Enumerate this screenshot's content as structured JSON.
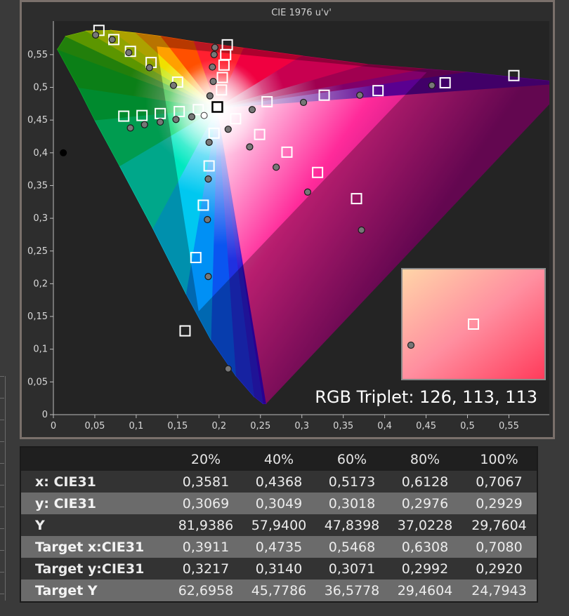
{
  "chart_data": {
    "type": "scatter",
    "title": "CIE 1976 u'v'",
    "xlim": [
      0,
      0.6
    ],
    "ylim": [
      0,
      0.6
    ],
    "x_ticks": [
      "0",
      "0,05",
      "0,1",
      "0,15",
      "0,2",
      "0,25",
      "0,3",
      "0,35",
      "0,4",
      "0,45",
      "0,5",
      "0,55"
    ],
    "y_ticks": [
      "0",
      "0,05",
      "0,1",
      "0,15",
      "0,2",
      "0,25",
      "0,3",
      "0,35",
      "0,4",
      "0,45",
      "0,5",
      "0,55"
    ],
    "grid": false,
    "series": [
      {
        "marker": "square",
        "points": [
          [
            0.055,
            0.587
          ],
          [
            0.073,
            0.573
          ],
          [
            0.093,
            0.555
          ],
          [
            0.118,
            0.538
          ],
          [
            0.15,
            0.508
          ],
          [
            0.085,
            0.456
          ],
          [
            0.107,
            0.457
          ],
          [
            0.129,
            0.46
          ],
          [
            0.152,
            0.463
          ],
          [
            0.175,
            0.466
          ],
          [
            0.198,
            0.47
          ],
          [
            0.22,
            0.452
          ],
          [
            0.194,
            0.43
          ],
          [
            0.188,
            0.38
          ],
          [
            0.181,
            0.32
          ],
          [
            0.172,
            0.24
          ],
          [
            0.159,
            0.128
          ],
          [
            0.21,
            0.565
          ],
          [
            0.208,
            0.55
          ],
          [
            0.206,
            0.534
          ],
          [
            0.204,
            0.515
          ],
          [
            0.203,
            0.496
          ],
          [
            0.258,
            0.478
          ],
          [
            0.327,
            0.488
          ],
          [
            0.392,
            0.495
          ],
          [
            0.473,
            0.507
          ],
          [
            0.556,
            0.518
          ],
          [
            0.249,
            0.428
          ],
          [
            0.282,
            0.401
          ],
          [
            0.319,
            0.37
          ],
          [
            0.366,
            0.33
          ]
        ]
      },
      {
        "marker": "circle",
        "points": [
          [
            0.051,
            0.58
          ],
          [
            0.071,
            0.573
          ],
          [
            0.091,
            0.553
          ],
          [
            0.116,
            0.53
          ],
          [
            0.145,
            0.503
          ],
          [
            0.093,
            0.438
          ],
          [
            0.11,
            0.443
          ],
          [
            0.129,
            0.447
          ],
          [
            0.148,
            0.451
          ],
          [
            0.167,
            0.455
          ],
          [
            0.211,
            0.436
          ],
          [
            0.188,
            0.416
          ],
          [
            0.187,
            0.36
          ],
          [
            0.186,
            0.298
          ],
          [
            0.187,
            0.211
          ],
          [
            0.211,
            0.07
          ],
          [
            0.195,
            0.561
          ],
          [
            0.194,
            0.55
          ],
          [
            0.192,
            0.531
          ],
          [
            0.193,
            0.509
          ],
          [
            0.189,
            0.487
          ],
          [
            0.24,
            0.466
          ],
          [
            0.302,
            0.477
          ],
          [
            0.37,
            0.488
          ],
          [
            0.457,
            0.503
          ],
          [
            0.237,
            0.409
          ],
          [
            0.269,
            0.378
          ],
          [
            0.307,
            0.34
          ],
          [
            0.372,
            0.282
          ]
        ]
      },
      {
        "marker": "white-dot",
        "points": [
          [
            0.182,
            0.457
          ]
        ]
      },
      {
        "marker": "black-dot",
        "points": [
          [
            0.012,
            0.4
          ]
        ]
      }
    ],
    "inset": {
      "label": "RGB Triplet: 126, 113, 113"
    },
    "table": {
      "columns": [
        "",
        "20%",
        "40%",
        "60%",
        "80%",
        "100%"
      ],
      "rows": [
        {
          "label": "x: CIE31",
          "values": [
            "0,3581",
            "0,4368",
            "0,5173",
            "0,6128",
            "0,7067"
          ]
        },
        {
          "label": "y: CIE31",
          "values": [
            "0,3069",
            "0,3049",
            "0,3018",
            "0,2976",
            "0,2929"
          ]
        },
        {
          "label": "Y",
          "values": [
            "81,9386",
            "57,9400",
            "47,8398",
            "37,0228",
            "29,7604"
          ]
        },
        {
          "label": "Target x:CIE31",
          "values": [
            "0,3911",
            "0,4735",
            "0,5468",
            "0,6308",
            "0,7080"
          ]
        },
        {
          "label": "Target y:CIE31",
          "values": [
            "0,3217",
            "0,3140",
            "0,3071",
            "0,2992",
            "0,2920"
          ]
        },
        {
          "label": "Target Y",
          "values": [
            "62,6958",
            "45,7786",
            "36,5778",
            "29,4604",
            "24,7943"
          ]
        }
      ]
    }
  }
}
